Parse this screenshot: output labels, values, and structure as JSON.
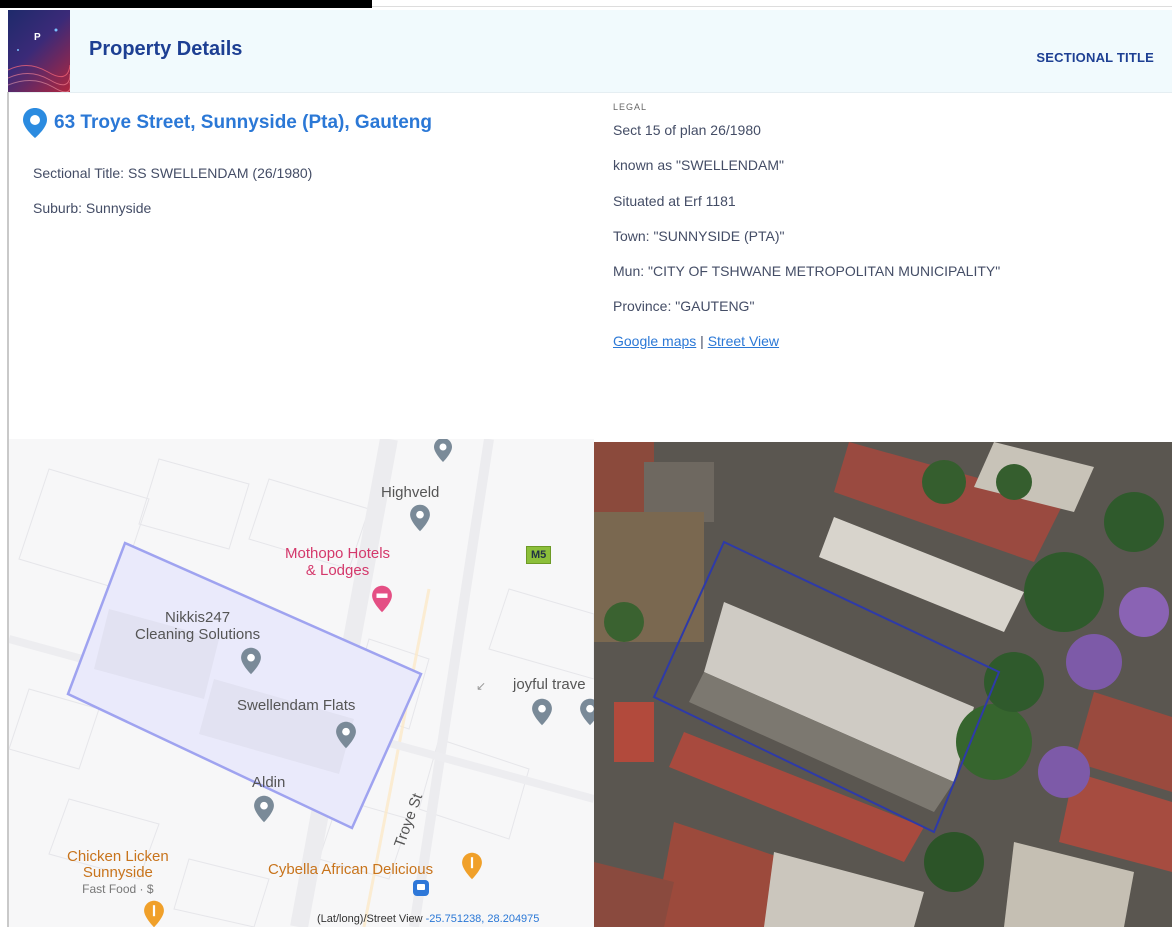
{
  "header": {
    "title": "Property Details",
    "type": "SECTIONAL TITLE",
    "logo_letter": "P"
  },
  "property": {
    "address": "63 Troye Street, Sunnyside (Pta), Gauteng",
    "sectional_title": "Sectional Title: SS SWELLENDAM (26/1980)",
    "suburb": "Suburb: Sunnyside"
  },
  "legal": {
    "heading": "LEGAL",
    "lines": [
      "Sect 15 of plan 26/1980",
      "known as \"SWELLENDAM\"",
      "Situated at Erf 1181",
      "Town: \"SUNNYSIDE (PTA)\"",
      "Mun: \"CITY OF TSHWANE METROPOLITAN MUNICIPALITY\"",
      "Province: \"GAUTENG\""
    ],
    "google_maps_link": "Google maps",
    "separator": "|",
    "street_view_link": "Street View"
  },
  "map": {
    "labels": {
      "highveld": "Highveld",
      "mothopo_1": "Mothopo Hotels",
      "mothopo_2": "& Lodges",
      "nikkis_1": "Nikkis247",
      "nikkis_2": "Cleaning Solutions",
      "swellendam": "Swellendam Flats",
      "joyful": "joyful trave",
      "aldin": "Aldin",
      "troye": "Troye St",
      "chicken_1": "Chicken Licken",
      "chicken_2": "Sunnyside",
      "chicken_3": "Fast Food · $",
      "cybella": "Cybella African Delicious",
      "road_badge": "M5"
    },
    "coords_label": "(Lat/long)/Street View ",
    "coords_value": "-25.751238, 28.204975"
  },
  "colors": {
    "accent": "#1d3f93",
    "link": "#2b78d6",
    "poi_red": "#d4386b",
    "poi_orange": "#c8741c",
    "parcel": "#9fa3f0"
  }
}
